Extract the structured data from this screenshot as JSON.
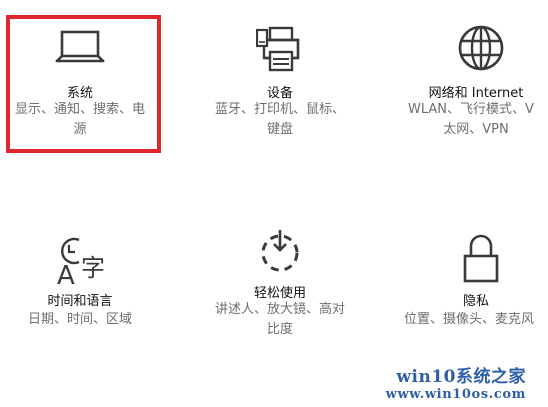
{
  "tiles": {
    "system": {
      "title": "系统",
      "desc_line1": "显示、通知、搜索、电",
      "desc_line2": "源",
      "icon": "laptop-icon"
    },
    "devices": {
      "title": "设备",
      "desc_line1": "蓝牙、打印机、鼠标、",
      "desc_line2": "键盘",
      "icon": "printer-icon"
    },
    "network": {
      "title": "网络和 Internet",
      "desc_line1": "WLAN、飞行模式、V",
      "desc_line2": "太网、VPN",
      "icon": "globe-icon"
    },
    "time": {
      "title": "时间和语言",
      "desc_line1": "日期、时间、区域",
      "icon": "time-language-icon"
    },
    "ease": {
      "title": "轻松使用",
      "desc_line1": "讲述人、放大镜、高对",
      "desc_line2": "比度",
      "icon": "ease-of-access-icon"
    },
    "privacy": {
      "title": "隐私",
      "desc_line1": "位置、摄像头、麦克风",
      "icon": "lock-icon"
    }
  },
  "watermark": {
    "line1": "win10系统之家",
    "line2": "www.win10os.com"
  },
  "colors": {
    "highlight": "#e0272f",
    "watermark": "#2f5fa6",
    "icon": "#3a3a3a",
    "desc_text": "#6e6e6e"
  }
}
